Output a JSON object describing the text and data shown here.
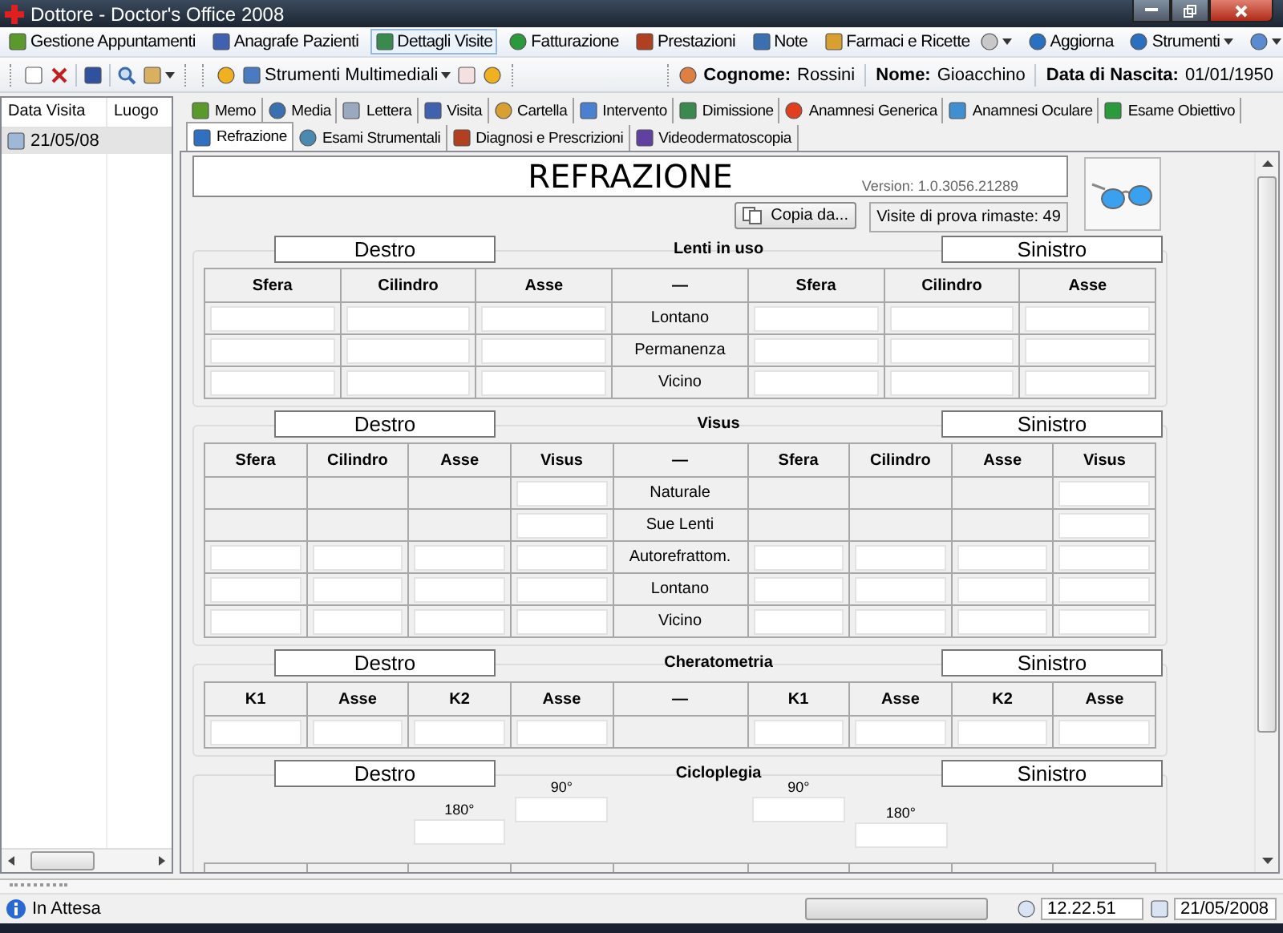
{
  "window": {
    "title": "Dottore - Doctor's Office 2008"
  },
  "menu": {
    "items": [
      {
        "label": "Gestione Appuntamenti",
        "selected": false
      },
      {
        "label": "Anagrafe Pazienti",
        "selected": false
      },
      {
        "label": "Dettagli Visite",
        "selected": true
      },
      {
        "label": "Fatturazione",
        "selected": false
      },
      {
        "label": "Prestazioni",
        "selected": false
      },
      {
        "label": "Note",
        "selected": false
      },
      {
        "label": "Farmaci e Ricette",
        "selected": false
      }
    ],
    "right_items": [
      {
        "label": "Aggiorna",
        "dropdown": false
      },
      {
        "label": "Strumenti",
        "dropdown": true
      }
    ]
  },
  "toolbar": {
    "multimedia": "Strumenti Multimediali"
  },
  "patient": [
    {
      "label": "Cognome:",
      "value": "Rossini"
    },
    {
      "label": "Nome:",
      "value": "Gioacchino"
    },
    {
      "label": "Data di Nascita:",
      "value": "01/01/1950"
    }
  ],
  "visits_list": {
    "columns": [
      "Data Visita",
      "Luogo"
    ],
    "rows": [
      {
        "date": "21/05/08",
        "selected": true
      }
    ]
  },
  "tab_rows": [
    {
      "tabs": [
        {
          "label": "Memo",
          "selected": false
        },
        {
          "label": "Media",
          "selected": false
        },
        {
          "label": "Lettera",
          "selected": false
        },
        {
          "label": "Visita",
          "selected": false
        },
        {
          "label": "Cartella",
          "selected": false
        },
        {
          "label": "Intervento",
          "selected": false
        },
        {
          "label": "Dimissione",
          "selected": false
        },
        {
          "label": "Anamnesi Generica",
          "selected": false
        },
        {
          "label": "Anamnesi Oculare",
          "selected": false
        },
        {
          "label": "Esame Obiettivo",
          "selected": false
        }
      ]
    },
    {
      "tabs": [
        {
          "label": "Refrazione",
          "selected": true
        },
        {
          "label": "Esami Strumentali",
          "selected": false
        },
        {
          "label": "Diagnosi e Prescrizioni",
          "selected": false
        },
        {
          "label": "Videodermatoscopia",
          "selected": false
        }
      ]
    }
  ],
  "panel": {
    "title": "REFRAZIONE",
    "version": "Version: 1.0.3056.21289",
    "copy_button": "Copia da...",
    "trial_visits": "Visite di prova rimaste: 49"
  },
  "sections": [
    {
      "title": "Lenti in uso",
      "left_label": "Destro",
      "right_label": "Sinistro",
      "left_columns": [
        "Sfera",
        "Cilindro",
        "Asse"
      ],
      "middle_column": "—",
      "right_columns": [
        "Sfera",
        "Cilindro",
        "Asse"
      ],
      "rows": [
        {
          "label": "Lontano",
          "left_fields": [
            true,
            true,
            true
          ],
          "right_fields": [
            true,
            true,
            true
          ]
        },
        {
          "label": "Permanenza",
          "left_fields": [
            true,
            true,
            true
          ],
          "right_fields": [
            true,
            true,
            true
          ]
        },
        {
          "label": "Vicino",
          "left_fields": [
            true,
            true,
            true
          ],
          "right_fields": [
            true,
            true,
            true
          ]
        }
      ]
    },
    {
      "title": "Visus",
      "left_label": "Destro",
      "right_label": "Sinistro",
      "left_columns": [
        "Sfera",
        "Cilindro",
        "Asse",
        "Visus"
      ],
      "middle_column": "—",
      "right_columns": [
        "Sfera",
        "Cilindro",
        "Asse",
        "Visus"
      ],
      "rows": [
        {
          "label": "Naturale",
          "left_fields": [
            false,
            false,
            false,
            true
          ],
          "right_fields": [
            false,
            false,
            false,
            true
          ]
        },
        {
          "label": "Sue Lenti",
          "left_fields": [
            false,
            false,
            false,
            true
          ],
          "right_fields": [
            false,
            false,
            false,
            true
          ]
        },
        {
          "label": "Autorefrattom.",
          "left_fields": [
            true,
            true,
            true,
            true
          ],
          "right_fields": [
            true,
            true,
            true,
            true
          ]
        },
        {
          "label": "Lontano",
          "left_fields": [
            true,
            true,
            true,
            true
          ],
          "right_fields": [
            true,
            true,
            true,
            true
          ]
        },
        {
          "label": "Vicino",
          "left_fields": [
            true,
            true,
            true,
            true
          ],
          "right_fields": [
            true,
            true,
            true,
            true
          ]
        }
      ]
    },
    {
      "title": "Cheratometria",
      "left_label": "Destro",
      "right_label": "Sinistro",
      "left_columns": [
        "K1",
        "Asse",
        "K2",
        "Asse"
      ],
      "middle_column": "—",
      "right_columns": [
        "K1",
        "Asse",
        "K2",
        "Asse"
      ],
      "rows": [
        {
          "left_fields": [
            true,
            true,
            true,
            true
          ],
          "right_fields": [
            true,
            true,
            true,
            true
          ]
        }
      ]
    }
  ],
  "cycloplegia": {
    "title": "Cicloplegia",
    "left_label": "Destro",
    "right_label": "Sinistro",
    "left_axes": [
      "180°",
      "90°"
    ],
    "right_axes": [
      "90°",
      "180°"
    ]
  },
  "status": {
    "text": "In Attesa",
    "progress": {
      "level": 0
    },
    "time": "12.22.51",
    "date": "21/05/2008"
  }
}
